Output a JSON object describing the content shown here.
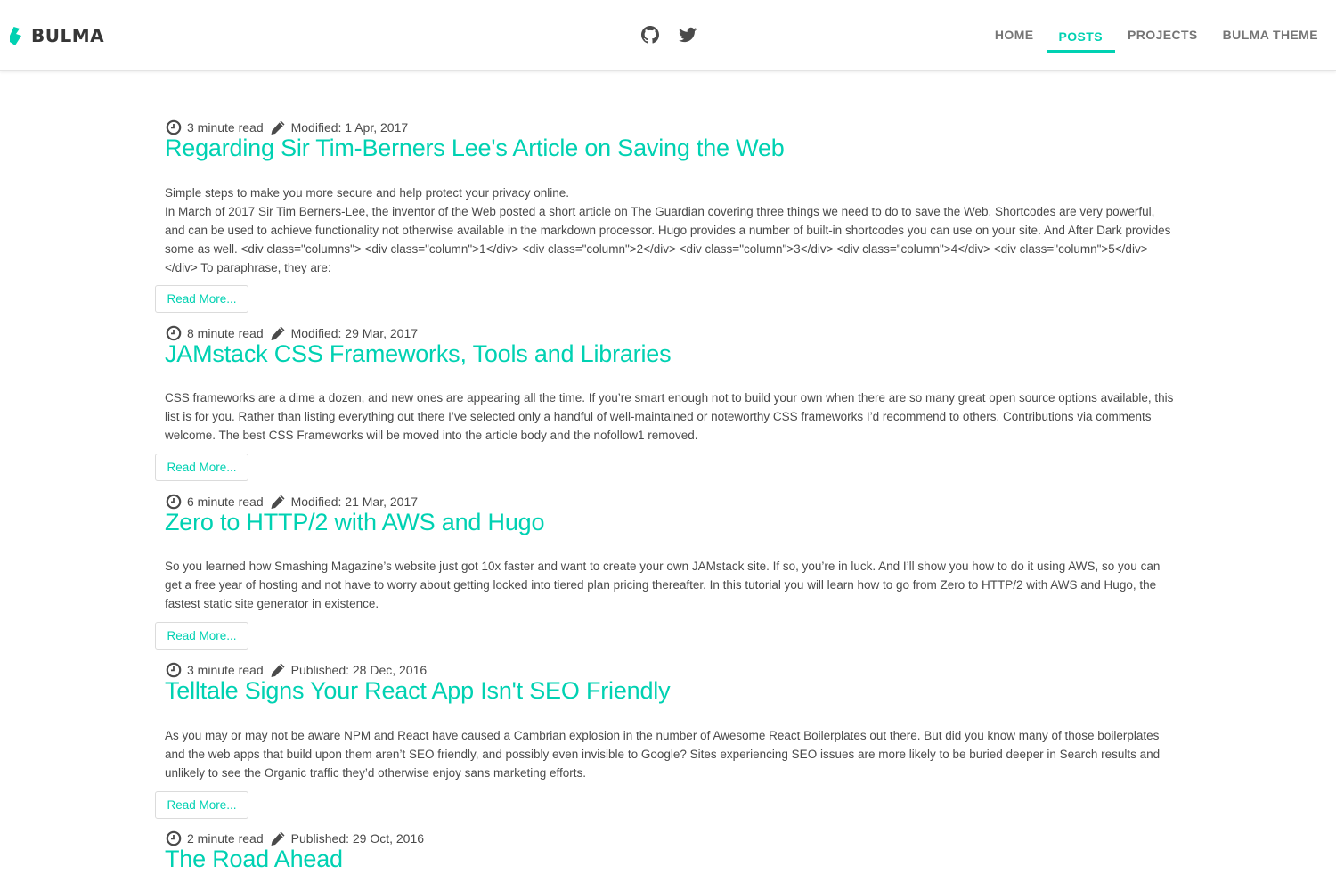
{
  "navbar": {
    "brand": "BULMA",
    "social": [
      "github-icon",
      "twitter-icon"
    ],
    "menu": [
      {
        "label": "HOME",
        "active": false
      },
      {
        "label": "POSTS",
        "active": true
      },
      {
        "label": "PROJECTS",
        "active": false
      },
      {
        "label": "BULMA THEME",
        "active": false
      }
    ]
  },
  "colors": {
    "accent": "#00d1b2",
    "text": "#4a4a4a",
    "nav_text": "#757575",
    "border": "#dbdbdb"
  },
  "posts": [
    {
      "read_time": "3 minute read",
      "date_label": "Modified: 1 Apr, 2017",
      "title": "Regarding Sir Tim-Berners Lee's Article on Saving the Web",
      "summary_lead": "Simple steps to make you more secure and help protect your privacy online.",
      "summary": "In March of 2017 Sir Tim Berners-Lee, the inventor of the Web posted a short article on The Guardian covering three things we need to do to save the Web. Shortcodes are very powerful, and can be used to achieve functionality not otherwise available in the markdown processor. Hugo provides a number of built-in shortcodes you can use on your site. And After Dark provides some as well. <div class=\"columns\"> <div class=\"column\">1</div> <div class=\"column\">2</div> <div class=\"column\">3</div> <div class=\"column\">4</div> <div class=\"column\">5</div> </div> To paraphrase, they are:",
      "read_more": "Read More..."
    },
    {
      "read_time": "8 minute read",
      "date_label": "Modified: 29 Mar, 2017",
      "title": "JAMstack CSS Frameworks, Tools and Libraries",
      "summary": "CSS frameworks are a dime a dozen, and new ones are appearing all the time. If you’re smart enough not to build your own when there are so many great open source options available, this list is for you. Rather than listing everything out there I’ve selected only a handful of well-maintained or noteworthy CSS frameworks I’d recommend to others. Contributions via comments welcome. The best CSS Frameworks will be moved into the article body and the nofollow1 removed.",
      "read_more": "Read More..."
    },
    {
      "read_time": "6 minute read",
      "date_label": "Modified: 21 Mar, 2017",
      "title": "Zero to HTTP/2 with AWS and Hugo",
      "summary": "So you learned how Smashing Magazine’s website just got 10x faster and want to create your own JAMstack site. If so, you’re in luck. And I’ll show you how to do it using AWS, so you can get a free year of hosting and not have to worry about getting locked into tiered plan pricing thereafter. In this tutorial you will learn how to go from Zero to HTTP/2 with AWS and Hugo, the fastest static site generator in existence.",
      "read_more": "Read More..."
    },
    {
      "read_time": "3 minute read",
      "date_label": "Published: 28 Dec, 2016",
      "title": "Telltale Signs Your React App Isn't SEO Friendly",
      "summary": "As you may or may not be aware NPM and React have caused a Cambrian explosion in the number of Awesome React Boilerplates out there. But did you know many of those boilerplates and the web apps that build upon them aren’t SEO friendly, and possibly even invisible to Google? Sites experiencing SEO issues are more likely to be buried deeper in Search results and unlikely to see the Organic traffic they’d otherwise enjoy sans marketing efforts.",
      "read_more": "Read More..."
    },
    {
      "read_time": "2 minute read",
      "date_label": "Published: 29 Oct, 2016",
      "title": "The Road Ahead"
    }
  ]
}
